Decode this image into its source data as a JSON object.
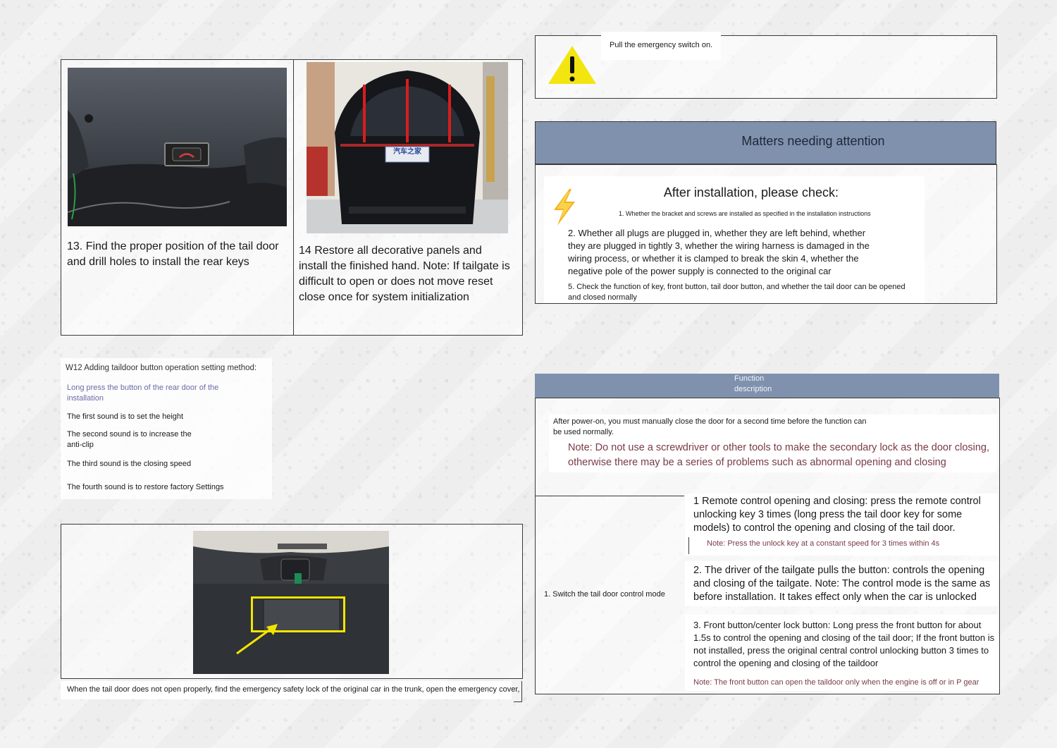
{
  "install_steps": {
    "step13": {
      "caption": "13. Find the proper position of the tail door and drill holes to install the rear keys"
    },
    "step14": {
      "caption": "14 Restore all decorative panels and install the finished hand. Note: If tailgate is difficult to open or does not move reset close once for system initialization",
      "plate_text": "汽车之家"
    }
  },
  "button_settings": {
    "heading": "W12 Adding taildoor button operation setting method:",
    "long_press": "Long press the button of the rear door of the installation",
    "items": [
      "The first sound is to set the height",
      "The second sound is to increase the anti-clip",
      "The third sound is the closing speed",
      "The fourth sound is to restore factory Settings"
    ]
  },
  "emergency": {
    "caption": "When the tail door does not open properly, find the emergency safety lock of the original car in the trunk, open the emergency cover,",
    "warning_text": "Pull the emergency switch on."
  },
  "attention": {
    "title": "Matters needing attention",
    "check_title": "After installation, please check:",
    "checks": [
      "1. Whether the bracket and screws are installed as specified in the installation instructions",
      "2. Whether all plugs are plugged in, whether they are left behind, whether they are plugged in tightly 3, whether the wiring harness is damaged in the wiring process, or whether it is clamped to break the skin 4, whether the negative pole of the power supply is connected to the original car",
      "5. Check the function of key, front button, tail door button, and whether the tail door can be opened and closed normally"
    ]
  },
  "function": {
    "title": "Function description",
    "power_on": "After power-on, you must manually close the door for a second time before the function can be used normally.",
    "note_screwdriver": "Note: Do not use a screwdriver or other tools to make the secondary lock as the door closing, otherwise there may be a series of problems such as abnormal opening and closing",
    "mode_label": "1. Switch the tail door control mode",
    "modes": [
      {
        "text": "1 Remote control opening and closing: press the remote control unlocking key 3 times (long press the tail door key for some models) to control the opening and closing of the tail door.",
        "note": "Note: Press the unlock key at a constant speed for 3 times within 4s"
      },
      {
        "text": "2. The driver of the tailgate pulls the button: controls the opening and closing of the tailgate. Note: The control mode is the same as before installation. It takes effect only when the car is unlocked",
        "note": ""
      },
      {
        "text": "3. Front button/center lock button: Long press the front button for about 1.5s to control the opening and closing of the tail door; If the front button is not installed, press the original central control unlocking button 3 times to control the opening and closing of the taildoor",
        "note": "Note: The front button can open the taildoor only when the engine is off or in P gear"
      }
    ]
  },
  "colors": {
    "header_bar": "#7f91ad",
    "note_maroon": "#7a3b46",
    "note_purple": "#6b6aa8",
    "warning_yellow": "#f3e510",
    "highlight_yellow": "#f2e400",
    "rod_red": "#d81d1d"
  },
  "icons": [
    "warning-triangle-icon",
    "lightning-icon",
    "tail-door-button-icon",
    "arrow-icon"
  ]
}
